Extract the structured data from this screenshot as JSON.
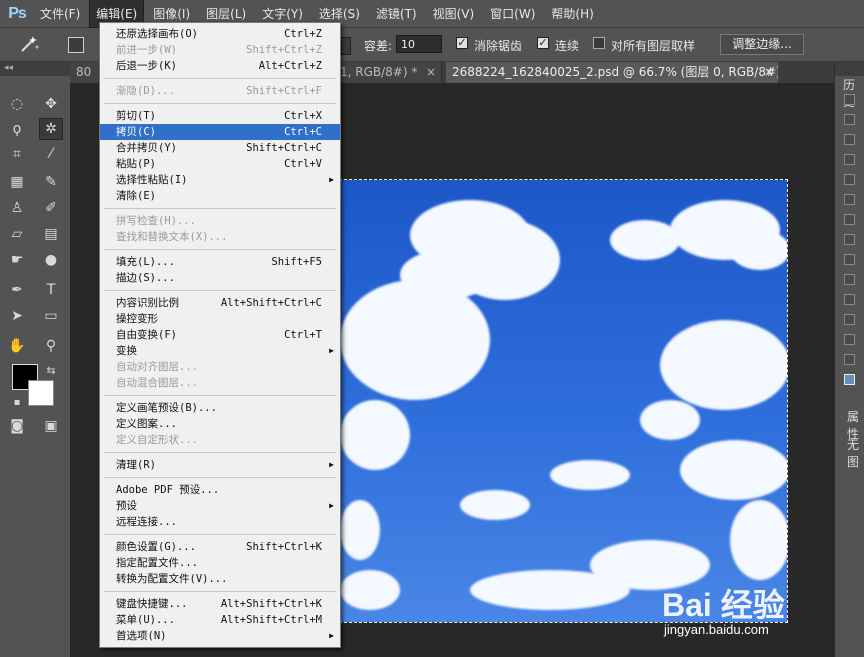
{
  "app": {
    "logo": "Ps"
  },
  "menubar": {
    "items": [
      "文件(F)",
      "编辑(E)",
      "图像(I)",
      "图层(L)",
      "文字(Y)",
      "选择(S)",
      "滤镜(T)",
      "视图(V)",
      "窗口(W)",
      "帮助(H)"
    ],
    "active_index": 1
  },
  "options": {
    "tolerance_label": "容差:",
    "tolerance_value": "10",
    "antialias_label": "消除锯齿",
    "contiguous_label": "连续",
    "sample_all_label": "对所有图层取样",
    "refine_edge_label": "调整边缘..."
  },
  "tabs": [
    {
      "label": "80",
      "tail": "1, RGB/8#) *",
      "close": "×"
    },
    {
      "label": "2688224_162840025_2.psd @ 66.7% (图层 0, RGB/8#)",
      "close": "×"
    }
  ],
  "edit_menu": {
    "items": [
      {
        "label": "还原选择画布(O)",
        "shortcut": "Ctrl+Z",
        "disabled": false
      },
      {
        "label": "前进一步(W)",
        "shortcut": "Shift+Ctrl+Z",
        "disabled": true
      },
      {
        "label": "后退一步(K)",
        "shortcut": "Alt+Ctrl+Z",
        "disabled": false
      },
      {
        "sep": true
      },
      {
        "label": "渐隐(D)...",
        "shortcut": "Shift+Ctrl+F",
        "disabled": true
      },
      {
        "sep": true
      },
      {
        "label": "剪切(T)",
        "shortcut": "Ctrl+X",
        "disabled": false
      },
      {
        "label": "拷贝(C)",
        "shortcut": "Ctrl+C",
        "disabled": false,
        "highlight": true
      },
      {
        "label": "合并拷贝(Y)",
        "shortcut": "Shift+Ctrl+C",
        "disabled": false
      },
      {
        "label": "粘贴(P)",
        "shortcut": "Ctrl+V",
        "disabled": false
      },
      {
        "label": "选择性粘贴(I)",
        "shortcut": "",
        "submenu": true,
        "disabled": false
      },
      {
        "label": "清除(E)",
        "shortcut": "",
        "disabled": false
      },
      {
        "sep": true
      },
      {
        "label": "拼写检查(H)...",
        "shortcut": "",
        "disabled": true
      },
      {
        "label": "查找和替换文本(X)...",
        "shortcut": "",
        "disabled": true
      },
      {
        "sep": true
      },
      {
        "label": "填充(L)...",
        "shortcut": "Shift+F5",
        "disabled": false
      },
      {
        "label": "描边(S)...",
        "shortcut": "",
        "disabled": false
      },
      {
        "sep": true
      },
      {
        "label": "内容识别比例",
        "shortcut": "Alt+Shift+Ctrl+C",
        "disabled": false
      },
      {
        "label": "操控变形",
        "shortcut": "",
        "disabled": false
      },
      {
        "label": "自由变换(F)",
        "shortcut": "Ctrl+T",
        "disabled": false
      },
      {
        "label": "变换",
        "shortcut": "",
        "submenu": true,
        "disabled": false
      },
      {
        "label": "自动对齐图层...",
        "shortcut": "",
        "disabled": true
      },
      {
        "label": "自动混合图层...",
        "shortcut": "",
        "disabled": true
      },
      {
        "sep": true
      },
      {
        "label": "定义画笔预设(B)...",
        "shortcut": "",
        "disabled": false
      },
      {
        "label": "定义图案...",
        "shortcut": "",
        "disabled": false
      },
      {
        "label": "定义自定形状...",
        "shortcut": "",
        "disabled": true
      },
      {
        "sep": true
      },
      {
        "label": "清理(R)",
        "shortcut": "",
        "submenu": true,
        "disabled": false
      },
      {
        "sep": true
      },
      {
        "label": "Adobe PDF 预设...",
        "shortcut": "",
        "disabled": false
      },
      {
        "label": "预设",
        "shortcut": "",
        "submenu": true,
        "disabled": false
      },
      {
        "label": "远程连接...",
        "shortcut": "",
        "disabled": false
      },
      {
        "sep": true
      },
      {
        "label": "颜色设置(G)...",
        "shortcut": "Shift+Ctrl+K",
        "disabled": false
      },
      {
        "label": "指定配置文件...",
        "shortcut": "",
        "disabled": false
      },
      {
        "label": "转换为配置文件(V)...",
        "shortcut": "",
        "disabled": false
      },
      {
        "sep": true
      },
      {
        "label": "键盘快捷键...",
        "shortcut": "Alt+Shift+Ctrl+K",
        "disabled": false
      },
      {
        "label": "菜单(U)...",
        "shortcut": "Alt+Shift+Ctrl+M",
        "disabled": false
      },
      {
        "label": "首选项(N)",
        "shortcut": "",
        "submenu": true,
        "disabled": false
      }
    ]
  },
  "right_panel": {
    "tab1": "历史",
    "tab2": "属性",
    "value": "无图"
  },
  "watermark": {
    "brand": "Bai 经验",
    "url": "jingyan.baidu.com"
  }
}
